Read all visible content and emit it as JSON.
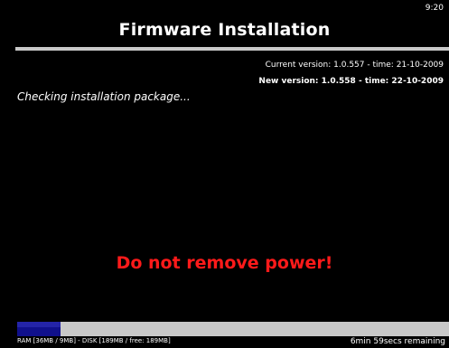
{
  "clock": "9:20",
  "title": "Firmware Installation",
  "versions": {
    "current": "Current version: 1.0.557 - time: 21-10-2009",
    "new": "New version: 1.0.558 - time: 22-10-2009"
  },
  "status": "Checking installation package...",
  "warning": "Do not remove power!",
  "progress": {
    "fraction": 0.1
  },
  "memory_info": "RAM [36MB / 9MB] - DISK [189MB / free: 189MB]",
  "time_remaining": "6min 59secs remaining",
  "colors": {
    "background": "#000000",
    "text": "#ffffff",
    "warning": "#ff1a1a",
    "progress_fill": "#10108c",
    "progress_track": "#c8c8c8"
  }
}
